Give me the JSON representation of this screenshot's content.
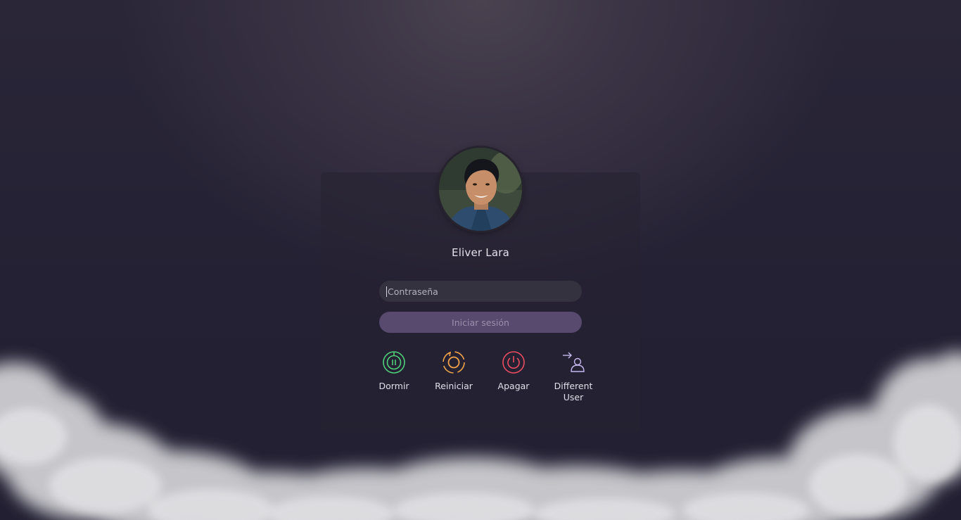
{
  "user": {
    "name": "Eliver Lara"
  },
  "login": {
    "password_placeholder": "Contraseña",
    "submit_label": "Iniciar sesión"
  },
  "actions": [
    {
      "label": "Dormir",
      "icon": "sleep-icon",
      "color": "#4fd17a"
    },
    {
      "label": "Reiniciar",
      "icon": "restart-icon",
      "color": "#f0a24a"
    },
    {
      "label": "Apagar",
      "icon": "power-icon",
      "color": "#ea4d63"
    },
    {
      "label": "Different User",
      "icon": "switch-user-icon",
      "color": "#c6b9f0"
    }
  ],
  "colors": {
    "background": "#232033",
    "panel": "#262332",
    "input": "#35323f",
    "accent": "#58496f"
  }
}
